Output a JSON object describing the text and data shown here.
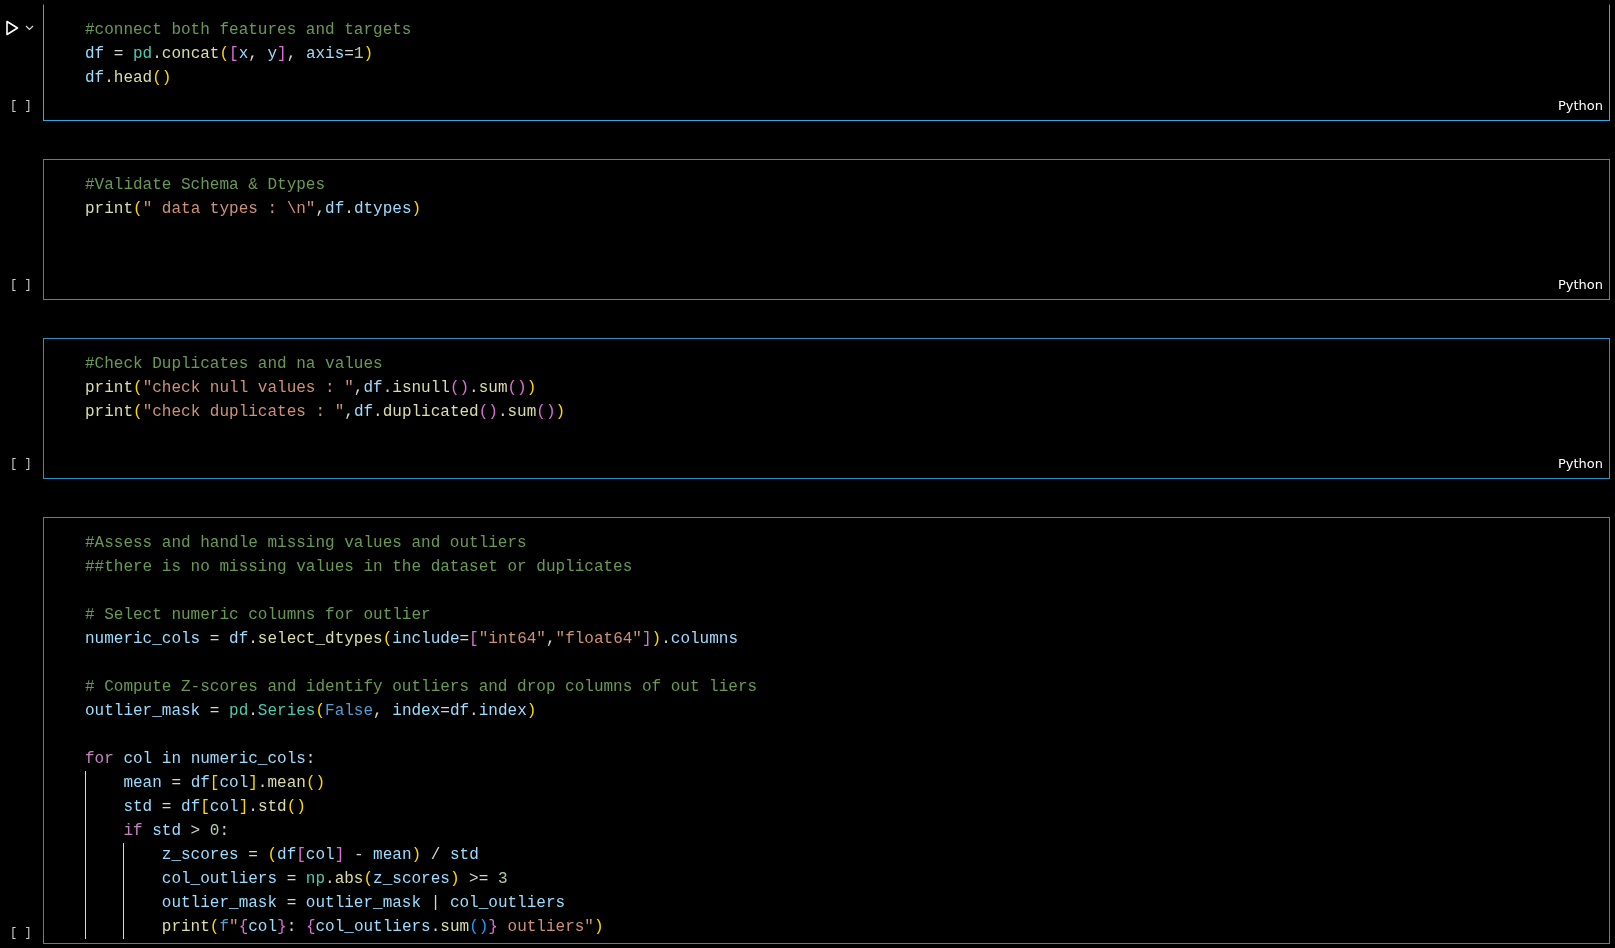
{
  "cells": [
    {
      "active": true,
      "exec_count": "[ ]",
      "language": "Python",
      "lines": [
        {
          "kind": "code",
          "tokens": [
            {
              "kind": "comment",
              "t": "#connect both features and targets"
            }
          ]
        },
        {
          "kind": "code",
          "tokens": [
            {
              "kind": "var",
              "t": "df"
            },
            {
              "kind": "punct",
              "t": " = "
            },
            {
              "kind": "module",
              "t": "pd"
            },
            {
              "kind": "punct",
              "t": "."
            },
            {
              "kind": "func",
              "t": "concat"
            },
            {
              "kind": "b1",
              "t": "("
            },
            {
              "kind": "b2",
              "t": "["
            },
            {
              "kind": "var",
              "t": "x"
            },
            {
              "kind": "punct",
              "t": ", "
            },
            {
              "kind": "var",
              "t": "y"
            },
            {
              "kind": "b2",
              "t": "]"
            },
            {
              "kind": "punct",
              "t": ", "
            },
            {
              "kind": "var",
              "t": "axis"
            },
            {
              "kind": "punct",
              "t": "="
            },
            {
              "kind": "number",
              "t": "1"
            },
            {
              "kind": "b1",
              "t": ")"
            }
          ]
        },
        {
          "kind": "code",
          "tokens": [
            {
              "kind": "var",
              "t": "df"
            },
            {
              "kind": "punct",
              "t": "."
            },
            {
              "kind": "func",
              "t": "head"
            },
            {
              "kind": "b1",
              "t": "()"
            }
          ]
        }
      ]
    },
    {
      "active": false,
      "exec_count": "[ ]",
      "language": "Python",
      "lines": [
        {
          "kind": "code",
          "tokens": [
            {
              "kind": "comment",
              "t": "#Validate Schema & Dtypes"
            }
          ]
        },
        {
          "kind": "code",
          "tokens": [
            {
              "kind": "func",
              "t": "print"
            },
            {
              "kind": "b1",
              "t": "("
            },
            {
              "kind": "string",
              "t": "\" data types : \\n\""
            },
            {
              "kind": "punct",
              "t": ","
            },
            {
              "kind": "var",
              "t": "df"
            },
            {
              "kind": "punct",
              "t": "."
            },
            {
              "kind": "var",
              "t": "dtypes"
            },
            {
              "kind": "b1",
              "t": ")"
            }
          ]
        },
        {
          "kind": "blank"
        },
        {
          "kind": "blank"
        }
      ]
    },
    {
      "active": false,
      "exec_count": "[ ]",
      "language": "Python",
      "lines": [
        {
          "kind": "code",
          "tokens": [
            {
              "kind": "comment",
              "t": "#Check Duplicates and na values"
            }
          ]
        },
        {
          "kind": "code",
          "tokens": [
            {
              "kind": "func",
              "t": "print"
            },
            {
              "kind": "b1",
              "t": "("
            },
            {
              "kind": "string",
              "t": "\"check null values : \""
            },
            {
              "kind": "punct",
              "t": ","
            },
            {
              "kind": "var",
              "t": "df"
            },
            {
              "kind": "punct",
              "t": "."
            },
            {
              "kind": "func",
              "t": "isnull"
            },
            {
              "kind": "b2",
              "t": "()"
            },
            {
              "kind": "punct",
              "t": "."
            },
            {
              "kind": "func",
              "t": "sum"
            },
            {
              "kind": "b2",
              "t": "()"
            },
            {
              "kind": "b1",
              "t": ")"
            }
          ]
        },
        {
          "kind": "code",
          "tokens": [
            {
              "kind": "func",
              "t": "print"
            },
            {
              "kind": "b1",
              "t": "("
            },
            {
              "kind": "string",
              "t": "\"check duplicates : \""
            },
            {
              "kind": "punct",
              "t": ","
            },
            {
              "kind": "var",
              "t": "df"
            },
            {
              "kind": "punct",
              "t": "."
            },
            {
              "kind": "func",
              "t": "duplicated"
            },
            {
              "kind": "b2",
              "t": "()"
            },
            {
              "kind": "punct",
              "t": "."
            },
            {
              "kind": "func",
              "t": "sum"
            },
            {
              "kind": "b2",
              "t": "()"
            },
            {
              "kind": "b1",
              "t": ")"
            }
          ]
        },
        {
          "kind": "blank"
        }
      ]
    },
    {
      "active": false,
      "exec_count": "[ ]",
      "lines": [
        {
          "kind": "code",
          "tokens": [
            {
              "kind": "comment",
              "t": "#Assess and handle missing values and outliers"
            }
          ]
        },
        {
          "kind": "code",
          "tokens": [
            {
              "kind": "comment",
              "t": "##there is no missing values in the dataset or duplicates"
            }
          ]
        },
        {
          "kind": "blank"
        },
        {
          "kind": "code",
          "tokens": [
            {
              "kind": "comment",
              "t": "# Select numeric columns for outlier"
            }
          ]
        },
        {
          "kind": "code",
          "tokens": [
            {
              "kind": "var",
              "t": "numeric_cols"
            },
            {
              "kind": "punct",
              "t": " = "
            },
            {
              "kind": "var",
              "t": "df"
            },
            {
              "kind": "punct",
              "t": "."
            },
            {
              "kind": "func",
              "t": "select_dtypes"
            },
            {
              "kind": "b1",
              "t": "("
            },
            {
              "kind": "var",
              "t": "include"
            },
            {
              "kind": "punct",
              "t": "="
            },
            {
              "kind": "b2",
              "t": "["
            },
            {
              "kind": "string",
              "t": "\"int64\""
            },
            {
              "kind": "punct",
              "t": ","
            },
            {
              "kind": "string",
              "t": "\"float64\""
            },
            {
              "kind": "b2",
              "t": "]"
            },
            {
              "kind": "b1",
              "t": ")"
            },
            {
              "kind": "punct",
              "t": "."
            },
            {
              "kind": "var",
              "t": "columns"
            }
          ]
        },
        {
          "kind": "blank"
        },
        {
          "kind": "code",
          "tokens": [
            {
              "kind": "comment",
              "t": "# Compute Z-scores and identify outliers and drop columns of out liers"
            }
          ]
        },
        {
          "kind": "code",
          "tokens": [
            {
              "kind": "var",
              "t": "outlier_mask"
            },
            {
              "kind": "punct",
              "t": " = "
            },
            {
              "kind": "module",
              "t": "pd"
            },
            {
              "kind": "punct",
              "t": "."
            },
            {
              "kind": "module",
              "t": "Series"
            },
            {
              "kind": "b1",
              "t": "("
            },
            {
              "kind": "constant",
              "t": "False"
            },
            {
              "kind": "punct",
              "t": ", "
            },
            {
              "kind": "var",
              "t": "index"
            },
            {
              "kind": "punct",
              "t": "="
            },
            {
              "kind": "var",
              "t": "df"
            },
            {
              "kind": "punct",
              "t": "."
            },
            {
              "kind": "var",
              "t": "index"
            },
            {
              "kind": "b1",
              "t": ")"
            }
          ]
        },
        {
          "kind": "blank"
        },
        {
          "kind": "code",
          "tokens": [
            {
              "kind": "keyword",
              "t": "for"
            },
            {
              "kind": "var",
              "t": " col in numeric_cols"
            },
            {
              "kind": "punct",
              "t": ":"
            }
          ],
          "children": [
            {
              "kind": "code",
              "tokens": [
                {
                  "kind": "var",
                  "t": "mean"
                },
                {
                  "kind": "punct",
                  "t": " = "
                },
                {
                  "kind": "var",
                  "t": "df"
                },
                {
                  "kind": "b1",
                  "t": "["
                },
                {
                  "kind": "var",
                  "t": "col"
                },
                {
                  "kind": "b1",
                  "t": "]"
                },
                {
                  "kind": "punct",
                  "t": "."
                },
                {
                  "kind": "func",
                  "t": "mean"
                },
                {
                  "kind": "b1",
                  "t": "()"
                }
              ]
            },
            {
              "kind": "code",
              "tokens": [
                {
                  "kind": "var",
                  "t": "std"
                },
                {
                  "kind": "punct",
                  "t": " = "
                },
                {
                  "kind": "var",
                  "t": "df"
                },
                {
                  "kind": "b1",
                  "t": "["
                },
                {
                  "kind": "var",
                  "t": "col"
                },
                {
                  "kind": "b1",
                  "t": "]"
                },
                {
                  "kind": "punct",
                  "t": "."
                },
                {
                  "kind": "func",
                  "t": "std"
                },
                {
                  "kind": "b1",
                  "t": "()"
                }
              ]
            },
            {
              "kind": "code",
              "tokens": [
                {
                  "kind": "keyword",
                  "t": "if"
                },
                {
                  "kind": "var",
                  "t": " std"
                },
                {
                  "kind": "punct",
                  "t": " > "
                },
                {
                  "kind": "number",
                  "t": "0"
                },
                {
                  "kind": "punct",
                  "t": ":"
                }
              ],
              "children": [
                {
                  "kind": "code",
                  "tokens": [
                    {
                      "kind": "var",
                      "t": "z_scores"
                    },
                    {
                      "kind": "punct",
                      "t": " = "
                    },
                    {
                      "kind": "b1",
                      "t": "("
                    },
                    {
                      "kind": "var",
                      "t": "df"
                    },
                    {
                      "kind": "b2",
                      "t": "["
                    },
                    {
                      "kind": "var",
                      "t": "col"
                    },
                    {
                      "kind": "b2",
                      "t": "]"
                    },
                    {
                      "kind": "punct",
                      "t": " - "
                    },
                    {
                      "kind": "var",
                      "t": "mean"
                    },
                    {
                      "kind": "b1",
                      "t": ")"
                    },
                    {
                      "kind": "punct",
                      "t": " / "
                    },
                    {
                      "kind": "var",
                      "t": "std"
                    }
                  ]
                },
                {
                  "kind": "code",
                  "tokens": [
                    {
                      "kind": "var",
                      "t": "col_outliers"
                    },
                    {
                      "kind": "punct",
                      "t": " = "
                    },
                    {
                      "kind": "module",
                      "t": "np"
                    },
                    {
                      "kind": "punct",
                      "t": "."
                    },
                    {
                      "kind": "func",
                      "t": "abs"
                    },
                    {
                      "kind": "b1",
                      "t": "("
                    },
                    {
                      "kind": "var",
                      "t": "z_scores"
                    },
                    {
                      "kind": "b1",
                      "t": ")"
                    },
                    {
                      "kind": "punct",
                      "t": " >= "
                    },
                    {
                      "kind": "number",
                      "t": "3"
                    }
                  ]
                },
                {
                  "kind": "code",
                  "tokens": [
                    {
                      "kind": "var",
                      "t": "outlier_mask"
                    },
                    {
                      "kind": "punct",
                      "t": " = "
                    },
                    {
                      "kind": "var",
                      "t": "outlier_mask"
                    },
                    {
                      "kind": "punct",
                      "t": " | "
                    },
                    {
                      "kind": "var",
                      "t": "col_outliers"
                    }
                  ]
                },
                {
                  "kind": "code",
                  "tokens": [
                    {
                      "kind": "func",
                      "t": "print"
                    },
                    {
                      "kind": "b1",
                      "t": "("
                    },
                    {
                      "kind": "constant",
                      "t": "f"
                    },
                    {
                      "kind": "string",
                      "t": "\""
                    },
                    {
                      "kind": "b2",
                      "t": "{"
                    },
                    {
                      "kind": "var",
                      "t": "col"
                    },
                    {
                      "kind": "b2",
                      "t": "}"
                    },
                    {
                      "kind": "punct",
                      "t": ": "
                    },
                    {
                      "kind": "b2",
                      "t": "{"
                    },
                    {
                      "kind": "var",
                      "t": "col_outliers"
                    },
                    {
                      "kind": "punct",
                      "t": "."
                    },
                    {
                      "kind": "func",
                      "t": "sum"
                    },
                    {
                      "kind": "b3",
                      "t": "()"
                    },
                    {
                      "kind": "b2",
                      "t": "}"
                    },
                    {
                      "kind": "string",
                      "t": " outliers\""
                    },
                    {
                      "kind": "b1",
                      "t": ")"
                    }
                  ]
                }
              ]
            }
          ]
        }
      ]
    }
  ]
}
